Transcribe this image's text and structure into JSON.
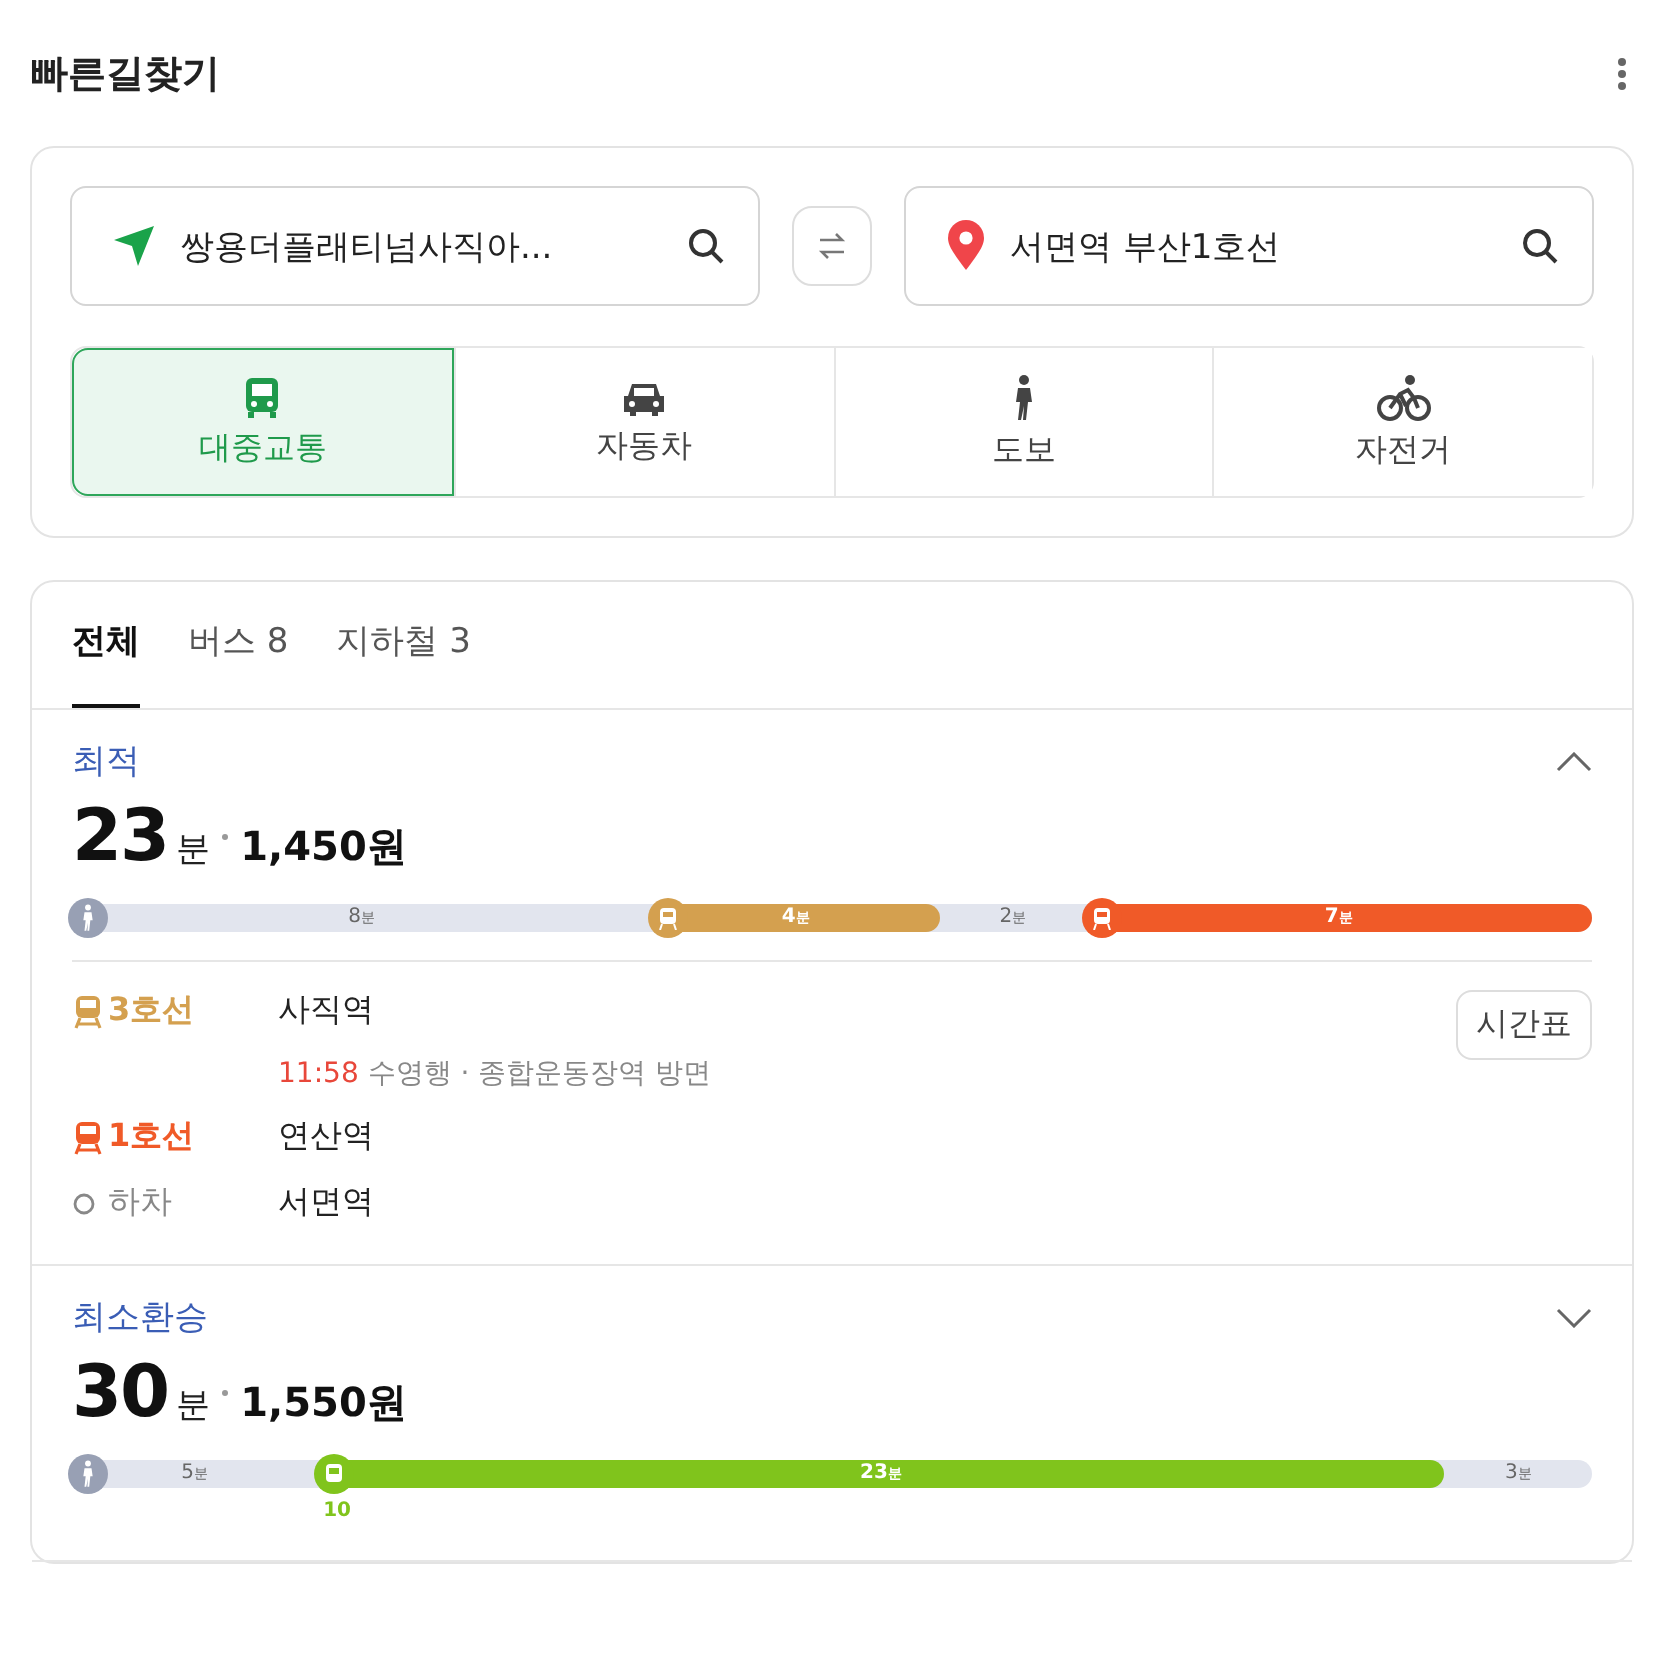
{
  "title": "빠른길찾기",
  "origin": {
    "value": "쌍용더플래티넘사직아..."
  },
  "destination": {
    "value": "서면역 부산1호선"
  },
  "modes": [
    {
      "kind": "transit",
      "label": "대중교통",
      "selected": true
    },
    {
      "kind": "car",
      "label": "자동차",
      "selected": false
    },
    {
      "kind": "walk",
      "label": "도보",
      "selected": false
    },
    {
      "kind": "bike",
      "label": "자전거",
      "selected": false
    }
  ],
  "tabs": [
    {
      "label": "전체",
      "selected": true
    },
    {
      "label": "버스 8",
      "selected": false
    },
    {
      "label": "지하철 3",
      "selected": false
    }
  ],
  "routes": [
    {
      "name": "최적",
      "expanded": true,
      "minutes": "23",
      "minutes_unit": "분",
      "fare": "1,450원",
      "segments": [
        {
          "kind": "walk",
          "minutes": "8",
          "unit": "분"
        },
        {
          "kind": "subway",
          "minutes": "4",
          "unit": "분",
          "color": "#d4a04f"
        },
        {
          "kind": "walk",
          "minutes": "2",
          "unit": "분"
        },
        {
          "kind": "subway",
          "minutes": "7",
          "unit": "분",
          "color": "#f05a28"
        }
      ],
      "steps": [
        {
          "kind": "line",
          "color": "#d4a04f",
          "label": "3호선",
          "station": "사직역",
          "time": "11:58",
          "detail": "수영행 · 종합운동장역 방면",
          "button": "시간표"
        },
        {
          "kind": "line",
          "color": "#f05a28",
          "label": "1호선",
          "station": "연산역"
        },
        {
          "kind": "alight",
          "label": "하차",
          "station": "서면역"
        }
      ]
    },
    {
      "name": "최소환승",
      "expanded": false,
      "minutes": "30",
      "minutes_unit": "분",
      "fare": "1,550원",
      "segments": [
        {
          "kind": "walk",
          "minutes": "5",
          "unit": "분"
        },
        {
          "kind": "bus",
          "minutes": "23",
          "unit": "분",
          "color": "#80c41c",
          "number": "10"
        },
        {
          "kind": "walk",
          "minutes": "3",
          "unit": "분"
        }
      ]
    }
  ]
}
